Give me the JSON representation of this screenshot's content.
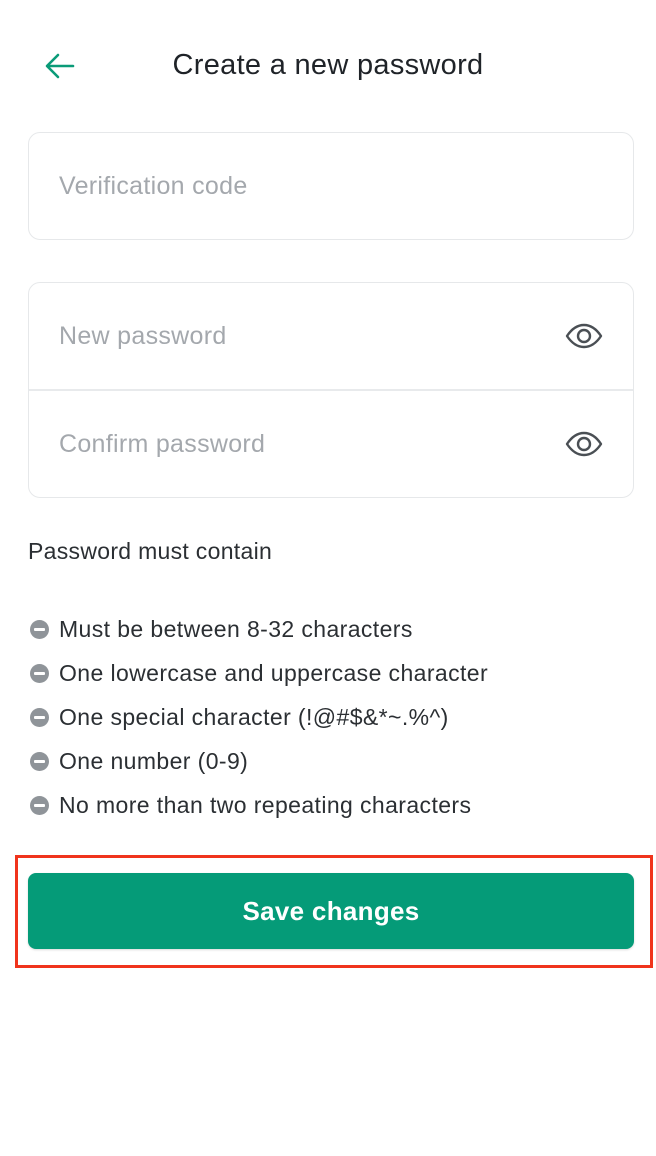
{
  "header": {
    "title": "Create a new password",
    "back_icon": "arrow-left-icon",
    "accent_color": "#0a9b78"
  },
  "form": {
    "verification_code": {
      "placeholder": "Verification code",
      "value": ""
    },
    "new_password": {
      "placeholder": "New password",
      "value": "",
      "icon": "eye-icon"
    },
    "confirm_password": {
      "placeholder": "Confirm password",
      "value": "",
      "icon": "eye-icon"
    }
  },
  "requirements": {
    "title": "Password must contain",
    "status_icon": "minus-circle-icon",
    "items": [
      "Must be between 8-32 characters",
      "One lowercase and uppercase character",
      "One special character (!@#$&*~.%^)",
      "One number (0-9)",
      "No more than two repeating characters"
    ]
  },
  "actions": {
    "save_label": "Save changes",
    "save_color": "#059b78",
    "highlight_color": "#f0341c"
  }
}
